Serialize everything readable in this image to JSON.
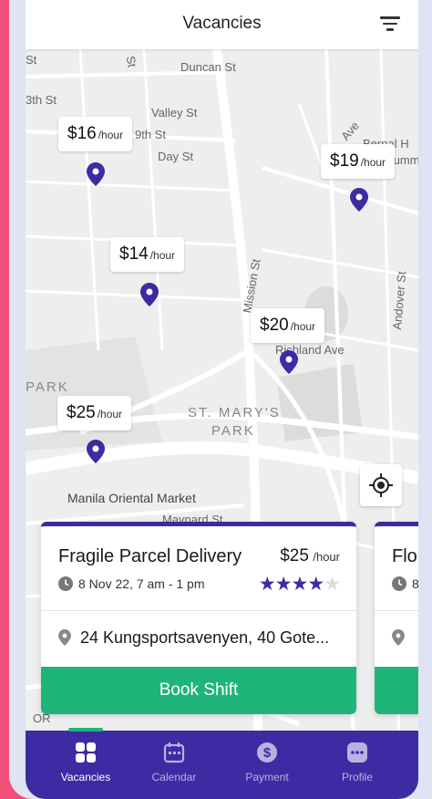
{
  "header": {
    "title": "Vacancies",
    "filter_icon": "filter-icon"
  },
  "map": {
    "streets": {
      "duncan": "Duncan St",
      "valley": "Valley St",
      "day": "Day St",
      "st_top": "St",
      "st_top2": "St",
      "third": "3th St",
      "ninth": "9th St",
      "mission": "Mission St",
      "andover": "Andover St",
      "richland": "Richland Ave",
      "park": "PARK",
      "st_marys": "ST. MARY'S",
      "st_marys2": "PARK",
      "manila": "Manila Oriental Market",
      "maynard": "Maynard St",
      "bernal": "Bernal H",
      "summ": "Summ",
      "ave": "Ave",
      "or": "OR"
    },
    "price_tags": [
      {
        "amount": "$16",
        "unit": "/hour"
      },
      {
        "amount": "$19",
        "unit": "/hour"
      },
      {
        "amount": "$14",
        "unit": "/hour"
      },
      {
        "amount": "$20",
        "unit": "/hour"
      },
      {
        "amount": "$25",
        "unit": "/hour"
      }
    ],
    "locate_icon": "crosshair-icon"
  },
  "cards": [
    {
      "title": "Fragile Parcel Delivery",
      "price": "$25",
      "unit": "/hour",
      "date": "8 Nov 22, 7 am - 1 pm",
      "rating": 4,
      "rating_max": 5,
      "address": "24 Kungsportsavenyen, 40 Gote...",
      "book_label": "Book Shift"
    },
    {
      "title": "Flo",
      "date": "8",
      "book_label": ""
    }
  ],
  "nav": [
    {
      "label": "Vacancies",
      "icon": "grid-icon",
      "active": true
    },
    {
      "label": "Calendar",
      "icon": "calendar-icon",
      "active": false
    },
    {
      "label": "Payment",
      "icon": "dollar-icon",
      "active": false
    },
    {
      "label": "Profile",
      "icon": "chat-icon",
      "active": false
    }
  ],
  "colors": {
    "primary": "#3d2ba3",
    "accent": "#1fb57a",
    "frame_pink": "#f2507a",
    "frame_lavender": "#dfe3f2"
  }
}
